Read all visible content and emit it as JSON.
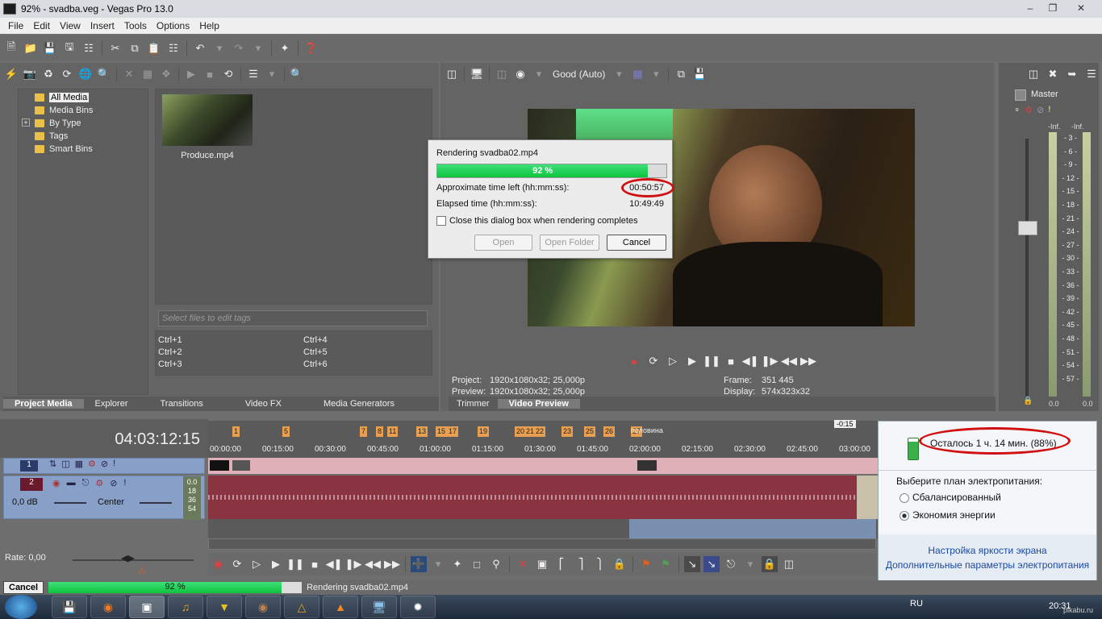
{
  "window": {
    "title": "92% - svadba.veg - Vegas Pro 13.0"
  },
  "menu": [
    "File",
    "Edit",
    "View",
    "Insert",
    "Tools",
    "Options",
    "Help"
  ],
  "explorer": {
    "tree": [
      {
        "label": "All Media",
        "selected": true
      },
      {
        "label": "Media Bins"
      },
      {
        "label": "By Type"
      },
      {
        "label": "Tags"
      },
      {
        "label": "Smart Bins"
      }
    ],
    "media_file": "Produce.mp4",
    "tag_placeholder": "Select files to edit tags",
    "shortcuts": [
      "Ctrl+1",
      "Ctrl+2",
      "Ctrl+3",
      "Ctrl+4",
      "Ctrl+5",
      "Ctrl+6"
    ],
    "tabs": [
      "Project Media",
      "Explorer",
      "Transitions",
      "Video FX",
      "Media Generators"
    ]
  },
  "preview": {
    "quality": "Good (Auto)",
    "project_label": "Project:",
    "project_value": "1920x1080x32; 25,000p",
    "preview_label": "Preview:",
    "preview_value": "1920x1080x32; 25,000p",
    "frame_label": "Frame:",
    "frame_value": "351 445",
    "display_label": "Display:",
    "display_value": "574x323x32",
    "tabs": [
      "Trimmer",
      "Video Preview"
    ]
  },
  "render_dialog": {
    "title": "Rendering svadba02.mp4",
    "progress_text": "92 %",
    "progress": 0.92,
    "time_left_label": "Approximate time left (hh:mm:ss):",
    "time_left_value": "00:50:57",
    "elapsed_label": "Elapsed time (hh:mm:ss):",
    "elapsed_value": "10:49:49",
    "checkbox_label": "Close this dialog box when rendering completes",
    "buttons": {
      "open": "Open",
      "open_folder": "Open Folder",
      "cancel": "Cancel"
    }
  },
  "mixer": {
    "title": "Master",
    "inf_left": "-Inf.",
    "inf_right": "-Inf.",
    "scale": [
      "3",
      "6",
      "9",
      "12",
      "15",
      "18",
      "21",
      "24",
      "27",
      "30",
      "33",
      "36",
      "39",
      "42",
      "45",
      "48",
      "51",
      "54",
      "57"
    ],
    "bottom_left": "0.0",
    "bottom_right": "0.0"
  },
  "timeline": {
    "timecode": "04:03:12:15",
    "time_labels": [
      "00:00:00",
      "00:15:00",
      "00:30:00",
      "00:45:00",
      "01:00:00",
      "01:15:00",
      "01:30:00",
      "01:45:00",
      "02:00:00",
      "02:15:00",
      "02:30:00",
      "02:45:00",
      "03:00:00"
    ],
    "markers": [
      "1",
      "5",
      "7",
      "8",
      "11",
      "13",
      "15",
      "17",
      "19",
      "20",
      "21",
      "22",
      "23",
      "25",
      "26",
      "27"
    ],
    "marker_27_label": "половина",
    "badge": "-0:15",
    "track1_num": "1",
    "track2_num": "2",
    "volume": "0,0 dB",
    "pan": "Center",
    "levels": [
      "18",
      "36",
      "54"
    ],
    "level_top": "0.0",
    "rate": "Rate: 0,00"
  },
  "battery": {
    "status": "Осталось 1 ч. 14 мин. (88%)",
    "plan_prompt": "Выберите план электропитания:",
    "plans": [
      {
        "label": "Сбалансированный",
        "selected": false
      },
      {
        "label": "Экономия энергии",
        "selected": true
      }
    ],
    "link1": "Настройка яркости экрана",
    "link2": "Дополнительные параметры электропитания"
  },
  "statusbar": {
    "cancel": "Cancel",
    "progress_text": "92 %",
    "progress": 0.92,
    "render_text": "Rendering svadba02.mp4"
  },
  "taskbar": {
    "lang": "RU",
    "clock": "20:31",
    "watermark": "pikabu.ru"
  }
}
